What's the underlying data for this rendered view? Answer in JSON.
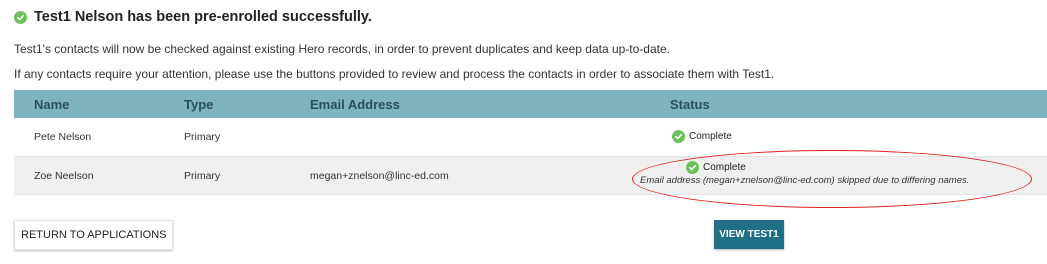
{
  "headline": {
    "text": "Test1 Nelson has been pre-enrolled successfully.",
    "icon": "check-circle-icon"
  },
  "paragraphs": {
    "p1": "Test1's contacts will now be checked against existing Hero records, in order to prevent duplicates and keep data up-to-date.",
    "p2": "If any contacts require your attention, please use the buttons provided to review and process the contacts in order to associate them with Test1."
  },
  "table": {
    "headers": {
      "name": "Name",
      "type": "Type",
      "email": "Email Address",
      "status": "Status"
    },
    "rows": [
      {
        "name": "Pete Nelson",
        "type": "Primary",
        "email": "",
        "status": "Complete",
        "note": ""
      },
      {
        "name": "Zoe Neelson",
        "type": "Primary",
        "email": "megan+znelson@linc-ed.com",
        "status": "Complete",
        "note": "Email address (megan+znelson@linc-ed.com) skipped due to differing names."
      }
    ]
  },
  "buttons": {
    "return": "RETURN TO APPLICATIONS",
    "view": "VIEW TEST1"
  },
  "colors": {
    "header_bg": "#7fb3bd",
    "check_green": "#6cc05a",
    "view_button_bg": "#1f6f86",
    "annotation_red": "#e02020"
  }
}
